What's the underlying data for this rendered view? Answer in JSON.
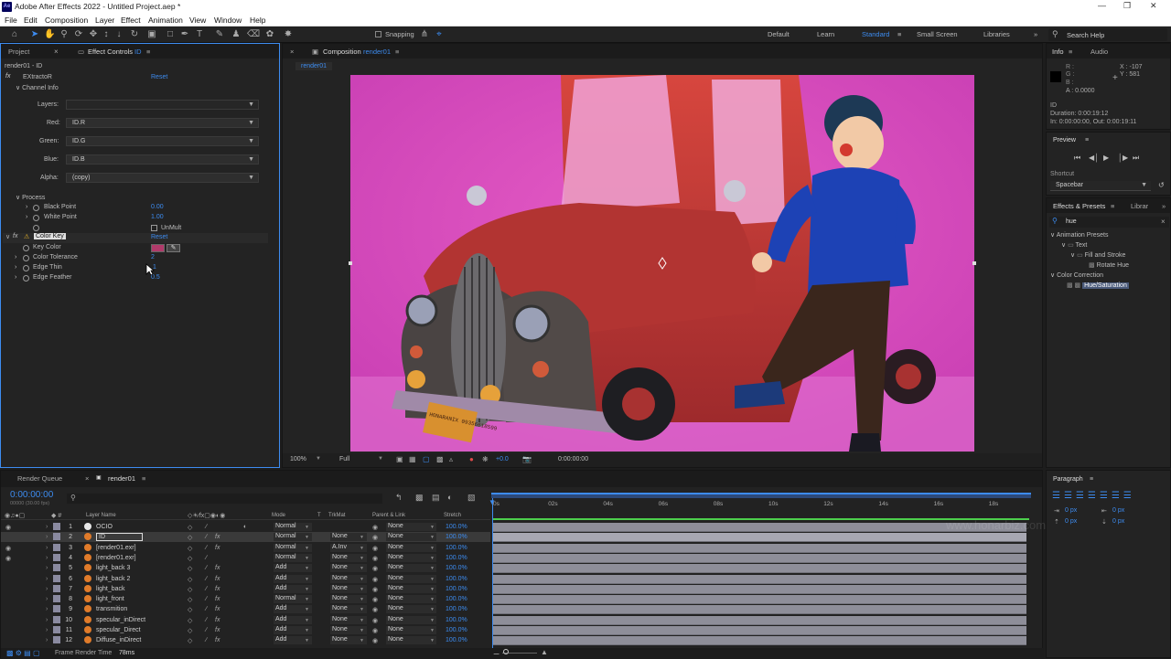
{
  "app": {
    "title": "Adobe After Effects 2022 - Untitled Project.aep *",
    "logo": "Ae"
  },
  "menu": [
    "File",
    "Edit",
    "Composition",
    "Layer",
    "Effect",
    "Animation",
    "View",
    "Window",
    "Help"
  ],
  "toolbar": {
    "snapping": "Snapping",
    "workspaces": [
      "Default",
      "Learn",
      "Standard",
      "Small Screen",
      "Libraries"
    ],
    "active_workspace": "Standard",
    "search_placeholder": "Search Help"
  },
  "left_panel": {
    "tabs": [
      "Project",
      "Effect Controls"
    ],
    "tab_suffix": "ID",
    "header": "render01 - ID",
    "effect1": {
      "name": "EXtractoR",
      "reset": "Reset",
      "group": "Channel Info",
      "rows": [
        {
          "label": "Layers:",
          "value": ""
        },
        {
          "label": "Red:",
          "value": "ID.R"
        },
        {
          "label": "Green:",
          "value": "ID.G"
        },
        {
          "label": "Blue:",
          "value": "ID.B"
        },
        {
          "label": "Alpha:",
          "value": "(copy)"
        }
      ],
      "process": "Process",
      "black_point": "Black Point",
      "black_value": "0.00",
      "white_point": "White Point",
      "white_value": "1.00",
      "unmult": "UnMult"
    },
    "effect2": {
      "name": "Color Key",
      "reset": "Reset",
      "key_color": "Key Color",
      "tolerance": "Color Tolerance",
      "tolerance_value": "2",
      "edge_thin": "Edge Thin",
      "edge_thin_value": "1",
      "edge_feather": "Edge Feather",
      "edge_feather_value": "0.5",
      "key_swatch": "#b03a6a"
    }
  },
  "composition": {
    "tab_label": "Composition",
    "comp_name": "render01",
    "subtab": "render01",
    "zoom": "100%",
    "resolution": "Full",
    "timecode": "0:00:00:00",
    "exposure": "+0.0",
    "plate_text": "HONARANIX 09356618599"
  },
  "info": {
    "tabs": [
      "Info",
      "Audio"
    ],
    "r": "R :",
    "g": "G :",
    "b": "B :",
    "a": "A : 0.0000",
    "x": "X : -107",
    "y": "Y : 581",
    "layer": "ID",
    "duration": "Duration: 0:00:19:12",
    "inout": "In: 0:00:00:00, Out: 0:00:19:11"
  },
  "preview": {
    "title": "Preview",
    "shortcut_label": "Shortcut",
    "shortcut_value": "Spacebar"
  },
  "effects_presets": {
    "tabs": [
      "Effects & Presets",
      "Librar"
    ],
    "search": "hue",
    "tree": [
      {
        "t": "Animation Presets",
        "lvl": 0
      },
      {
        "t": "Text",
        "lvl": 1
      },
      {
        "t": "Fill and Stroke",
        "lvl": 2
      },
      {
        "t": "Rotate Hue",
        "lvl": 3
      },
      {
        "t": "Color Correction",
        "lvl": 0
      },
      {
        "t": "Hue/Saturation",
        "lvl": 1
      }
    ]
  },
  "paragraph": {
    "title": "Paragraph",
    "values": [
      "0 px",
      "0 px",
      "0 px",
      "0 px"
    ]
  },
  "timeline": {
    "tabs": [
      "Render Queue",
      "render01"
    ],
    "timecode": "0:00:00:00",
    "fps": "00000 (30.00 fps)",
    "footer": "Frame Render Time",
    "render_time": "78ms",
    "headers": {
      "layer": "Layer Name",
      "mode": "Mode",
      "t": "T",
      "trkmat": "TrkMat",
      "parent": "Parent & Link",
      "stretch": "Stretch"
    },
    "ticks": [
      "0s",
      "02s",
      "04s",
      "06s",
      "08s",
      "10s",
      "12s",
      "14s",
      "16s",
      "18s"
    ],
    "layers": [
      {
        "n": "1",
        "name": "OCIO",
        "mode": "Normal",
        "trk": "",
        "parent": "None",
        "stretch": "100.0%",
        "color": "#e8e8e8"
      },
      {
        "n": "2",
        "name": "ID",
        "mode": "Normal",
        "trk": "None",
        "parent": "None",
        "stretch": "100.0%",
        "color": "#e07b2a"
      },
      {
        "n": "3",
        "name": "[render01.exr]",
        "mode": "Normal",
        "trk": "A.Inv",
        "parent": "None",
        "stretch": "100.0%",
        "color": "#e07b2a"
      },
      {
        "n": "4",
        "name": "[render01.exr]",
        "mode": "Normal",
        "trk": "None",
        "parent": "None",
        "stretch": "100.0%",
        "color": "#e07b2a"
      },
      {
        "n": "5",
        "name": "light_back 3",
        "mode": "Add",
        "trk": "None",
        "parent": "None",
        "stretch": "100.0%",
        "color": "#e07b2a"
      },
      {
        "n": "6",
        "name": "light_back 2",
        "mode": "Add",
        "trk": "None",
        "parent": "None",
        "stretch": "100.0%",
        "color": "#e07b2a"
      },
      {
        "n": "7",
        "name": "light_back",
        "mode": "Add",
        "trk": "None",
        "parent": "None",
        "stretch": "100.0%",
        "color": "#e07b2a"
      },
      {
        "n": "8",
        "name": "light_front",
        "mode": "Normal",
        "trk": "None",
        "parent": "None",
        "stretch": "100.0%",
        "color": "#e07b2a"
      },
      {
        "n": "9",
        "name": "transmition",
        "mode": "Add",
        "trk": "None",
        "parent": "None",
        "stretch": "100.0%",
        "color": "#e07b2a"
      },
      {
        "n": "10",
        "name": "specular_inDirect",
        "mode": "Add",
        "trk": "None",
        "parent": "None",
        "stretch": "100.0%",
        "color": "#e07b2a"
      },
      {
        "n": "11",
        "name": "specular_Direct",
        "mode": "Add",
        "trk": "None",
        "parent": "None",
        "stretch": "100.0%",
        "color": "#e07b2a"
      },
      {
        "n": "12",
        "name": "Diffuse_inDirect",
        "mode": "Add",
        "trk": "None",
        "parent": "None",
        "stretch": "100.0%",
        "color": "#e07b2a"
      }
    ]
  },
  "watermark": "www.honarbiz.com"
}
